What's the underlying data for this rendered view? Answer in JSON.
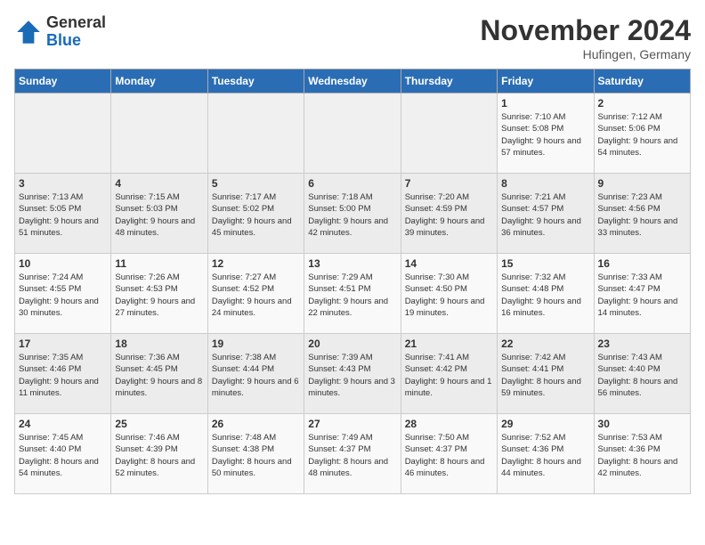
{
  "logo": {
    "general": "General",
    "blue": "Blue"
  },
  "header": {
    "title": "November 2024",
    "location": "Hufingen, Germany"
  },
  "weekdays": [
    "Sunday",
    "Monday",
    "Tuesday",
    "Wednesday",
    "Thursday",
    "Friday",
    "Saturday"
  ],
  "weeks": [
    [
      {
        "day": "",
        "info": ""
      },
      {
        "day": "",
        "info": ""
      },
      {
        "day": "",
        "info": ""
      },
      {
        "day": "",
        "info": ""
      },
      {
        "day": "",
        "info": ""
      },
      {
        "day": "1",
        "info": "Sunrise: 7:10 AM\nSunset: 5:08 PM\nDaylight: 9 hours and 57 minutes."
      },
      {
        "day": "2",
        "info": "Sunrise: 7:12 AM\nSunset: 5:06 PM\nDaylight: 9 hours and 54 minutes."
      }
    ],
    [
      {
        "day": "3",
        "info": "Sunrise: 7:13 AM\nSunset: 5:05 PM\nDaylight: 9 hours and 51 minutes."
      },
      {
        "day": "4",
        "info": "Sunrise: 7:15 AM\nSunset: 5:03 PM\nDaylight: 9 hours and 48 minutes."
      },
      {
        "day": "5",
        "info": "Sunrise: 7:17 AM\nSunset: 5:02 PM\nDaylight: 9 hours and 45 minutes."
      },
      {
        "day": "6",
        "info": "Sunrise: 7:18 AM\nSunset: 5:00 PM\nDaylight: 9 hours and 42 minutes."
      },
      {
        "day": "7",
        "info": "Sunrise: 7:20 AM\nSunset: 4:59 PM\nDaylight: 9 hours and 39 minutes."
      },
      {
        "day": "8",
        "info": "Sunrise: 7:21 AM\nSunset: 4:57 PM\nDaylight: 9 hours and 36 minutes."
      },
      {
        "day": "9",
        "info": "Sunrise: 7:23 AM\nSunset: 4:56 PM\nDaylight: 9 hours and 33 minutes."
      }
    ],
    [
      {
        "day": "10",
        "info": "Sunrise: 7:24 AM\nSunset: 4:55 PM\nDaylight: 9 hours and 30 minutes."
      },
      {
        "day": "11",
        "info": "Sunrise: 7:26 AM\nSunset: 4:53 PM\nDaylight: 9 hours and 27 minutes."
      },
      {
        "day": "12",
        "info": "Sunrise: 7:27 AM\nSunset: 4:52 PM\nDaylight: 9 hours and 24 minutes."
      },
      {
        "day": "13",
        "info": "Sunrise: 7:29 AM\nSunset: 4:51 PM\nDaylight: 9 hours and 22 minutes."
      },
      {
        "day": "14",
        "info": "Sunrise: 7:30 AM\nSunset: 4:50 PM\nDaylight: 9 hours and 19 minutes."
      },
      {
        "day": "15",
        "info": "Sunrise: 7:32 AM\nSunset: 4:48 PM\nDaylight: 9 hours and 16 minutes."
      },
      {
        "day": "16",
        "info": "Sunrise: 7:33 AM\nSunset: 4:47 PM\nDaylight: 9 hours and 14 minutes."
      }
    ],
    [
      {
        "day": "17",
        "info": "Sunrise: 7:35 AM\nSunset: 4:46 PM\nDaylight: 9 hours and 11 minutes."
      },
      {
        "day": "18",
        "info": "Sunrise: 7:36 AM\nSunset: 4:45 PM\nDaylight: 9 hours and 8 minutes."
      },
      {
        "day": "19",
        "info": "Sunrise: 7:38 AM\nSunset: 4:44 PM\nDaylight: 9 hours and 6 minutes."
      },
      {
        "day": "20",
        "info": "Sunrise: 7:39 AM\nSunset: 4:43 PM\nDaylight: 9 hours and 3 minutes."
      },
      {
        "day": "21",
        "info": "Sunrise: 7:41 AM\nSunset: 4:42 PM\nDaylight: 9 hours and 1 minute."
      },
      {
        "day": "22",
        "info": "Sunrise: 7:42 AM\nSunset: 4:41 PM\nDaylight: 8 hours and 59 minutes."
      },
      {
        "day": "23",
        "info": "Sunrise: 7:43 AM\nSunset: 4:40 PM\nDaylight: 8 hours and 56 minutes."
      }
    ],
    [
      {
        "day": "24",
        "info": "Sunrise: 7:45 AM\nSunset: 4:40 PM\nDaylight: 8 hours and 54 minutes."
      },
      {
        "day": "25",
        "info": "Sunrise: 7:46 AM\nSunset: 4:39 PM\nDaylight: 8 hours and 52 minutes."
      },
      {
        "day": "26",
        "info": "Sunrise: 7:48 AM\nSunset: 4:38 PM\nDaylight: 8 hours and 50 minutes."
      },
      {
        "day": "27",
        "info": "Sunrise: 7:49 AM\nSunset: 4:37 PM\nDaylight: 8 hours and 48 minutes."
      },
      {
        "day": "28",
        "info": "Sunrise: 7:50 AM\nSunset: 4:37 PM\nDaylight: 8 hours and 46 minutes."
      },
      {
        "day": "29",
        "info": "Sunrise: 7:52 AM\nSunset: 4:36 PM\nDaylight: 8 hours and 44 minutes."
      },
      {
        "day": "30",
        "info": "Sunrise: 7:53 AM\nSunset: 4:36 PM\nDaylight: 8 hours and 42 minutes."
      }
    ]
  ]
}
